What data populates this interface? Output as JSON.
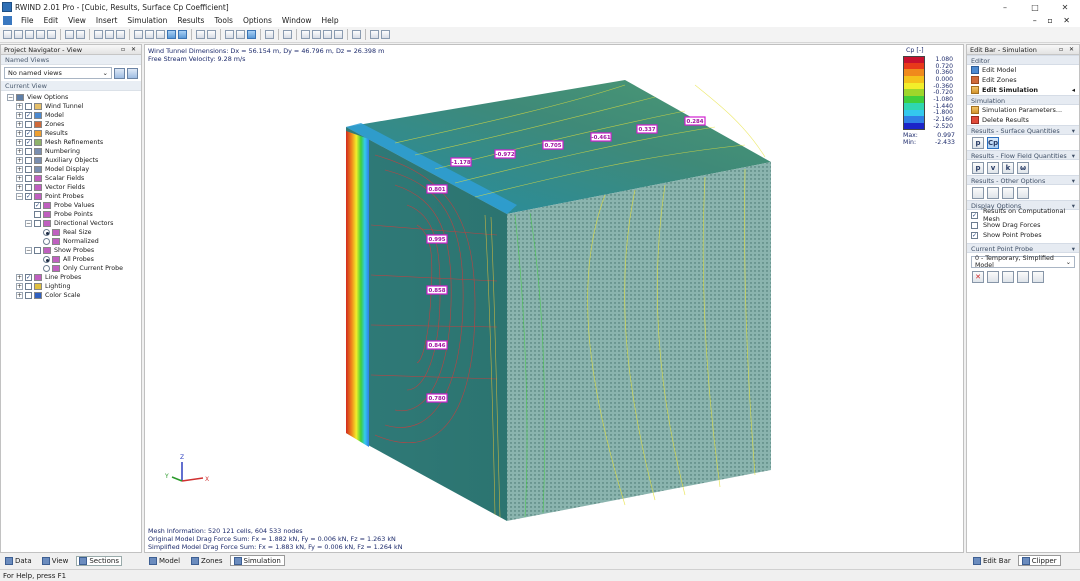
{
  "window": {
    "title": "RWIND 2.01 Pro - [Cubic, Results, Surface Cp Coefficient]",
    "minimize": "–",
    "maximize": "□",
    "close": "✕"
  },
  "menu": {
    "items": [
      "File",
      "Edit",
      "View",
      "Insert",
      "Simulation",
      "Results",
      "Tools",
      "Options",
      "Window",
      "Help"
    ],
    "mdi_controls": "– ▫ ✕"
  },
  "navigator": {
    "title": "Project Navigator - View",
    "pin": "▫ ✕",
    "named_views_label": "Named Views",
    "named_views_value": "No named views",
    "current_view_label": "Current View",
    "tree": [
      {
        "label": "View Options",
        "level": 0,
        "exp": "−",
        "cb": null,
        "icon": "#5f7fa8"
      },
      {
        "label": "Wind Tunnel",
        "level": 1,
        "exp": "+",
        "cb": "",
        "icon": "#e6c06a"
      },
      {
        "label": "Model",
        "level": 1,
        "exp": "+",
        "cb": "✓",
        "icon": "#4d8ad0"
      },
      {
        "label": "Zones",
        "level": 1,
        "exp": "+",
        "cb": "",
        "icon": "#d06a3a"
      },
      {
        "label": "Results",
        "level": 1,
        "exp": "+",
        "cb": "✓",
        "icon": "#f0a030"
      },
      {
        "label": "Mesh Refinements",
        "level": 1,
        "exp": "+",
        "cb": "✓",
        "icon": "#8fb36a"
      },
      {
        "label": "Numbering",
        "level": 1,
        "exp": "+",
        "cb": "",
        "icon": "#7a8fb0"
      },
      {
        "label": "Auxiliary Objects",
        "level": 1,
        "exp": "+",
        "cb": "",
        "icon": "#7a8fb0"
      },
      {
        "label": "Model Display",
        "level": 1,
        "exp": "+",
        "cb": "",
        "icon": "#7a8fb0"
      },
      {
        "label": "Scalar Fields",
        "level": 1,
        "exp": "+",
        "cb": "",
        "icon": "#c060c0"
      },
      {
        "label": "Vector Fields",
        "level": 1,
        "exp": "+",
        "cb": "",
        "icon": "#c060c0"
      },
      {
        "label": "Point Probes",
        "level": 1,
        "exp": "−",
        "cb": "✓",
        "icon": "#c060c0"
      },
      {
        "label": "Probe Values",
        "level": 2,
        "exp": null,
        "cb": "✓",
        "icon": "#c060c0"
      },
      {
        "label": "Probe Points",
        "level": 2,
        "exp": null,
        "cb": "",
        "icon": "#c060c0"
      },
      {
        "label": "Directional Vectors",
        "level": 2,
        "exp": "−",
        "cb": "",
        "icon": "#c060c0"
      },
      {
        "label": "Real Size",
        "level": 3,
        "exp": null,
        "radio": true,
        "icon": "#c060c0"
      },
      {
        "label": "Normalized",
        "level": 3,
        "exp": null,
        "radio": false,
        "icon": "#c060c0"
      },
      {
        "label": "Show Probes",
        "level": 2,
        "exp": "−",
        "cb": "",
        "icon": "#c060c0"
      },
      {
        "label": "All Probes",
        "level": 3,
        "exp": null,
        "radio": true,
        "icon": "#c060c0"
      },
      {
        "label": "Only Current Probe",
        "level": 3,
        "exp": null,
        "radio": false,
        "icon": "#c060c0"
      },
      {
        "label": "Line Probes",
        "level": 1,
        "exp": "+",
        "cb": "✓",
        "icon": "#c060c0"
      },
      {
        "label": "Lighting",
        "level": 1,
        "exp": "+",
        "cb": "",
        "icon": "#e0c040"
      },
      {
        "label": "Color Scale",
        "level": 1,
        "exp": "+",
        "cb": "",
        "icon": "#3060c0"
      }
    ],
    "tabs": [
      "Data",
      "View",
      "Sections"
    ]
  },
  "viewport": {
    "info_top_1": "Wind Tunnel Dimensions: Dx = 56.154 m, Dy = 46.796 m, Dz = 26.398 m",
    "info_top_2": "Free Stream Velocity: 9.28 m/s",
    "info_bottom_1": "Mesh Information: 520 121 cells, 604 533 nodes",
    "info_bottom_2": "Original Model Drag Force Sum: Fx = 1.882 kN, Fy = 0.006 kN, Fz = 1.263 kN",
    "info_bottom_3": "Simplified Model Drag Force Sum: Fx = 1.883 kN, Fy = 0.006 kN, Fz = 1.264 kN",
    "probe_labels": [
      "0.284",
      "0.337",
      "-0.461",
      "0.705",
      "-0.972",
      "-1.178",
      "0.801",
      "0.995",
      "0.858",
      "0.846",
      "0.780"
    ],
    "axes": {
      "x": "X",
      "y": "Y",
      "z": "Z"
    },
    "tabs": [
      "Model",
      "Zones",
      "Simulation"
    ]
  },
  "legend": {
    "title": "Cp [-]",
    "entries": [
      {
        "value": "1.080",
        "color": "#c8102e"
      },
      {
        "value": "0.720",
        "color": "#e8391a"
      },
      {
        "value": "0.360",
        "color": "#f08a1c"
      },
      {
        "value": "0.000",
        "color": "#f5c21b"
      },
      {
        "value": "-0.360",
        "color": "#f2ee2a"
      },
      {
        "value": "-0.720",
        "color": "#9fd62a"
      },
      {
        "value": "-1.080",
        "color": "#3fcf3c"
      },
      {
        "value": "-1.440",
        "color": "#2fd6b0"
      },
      {
        "value": "-1.800",
        "color": "#34c9ee"
      },
      {
        "value": "-2.160",
        "color": "#2f7fe6"
      },
      {
        "value": "-2.520",
        "color": "#1b24c8"
      }
    ],
    "max_label": "Max:",
    "max_value": "0.997",
    "min_label": "Min:",
    "min_value": "-2.433"
  },
  "editbar": {
    "title": "Edit Bar - Simulation",
    "pin": "▫ ✕",
    "editor_label": "Editor",
    "editor_items": [
      "Edit Model",
      "Edit Zones",
      "Edit Simulation"
    ],
    "simulation_label": "Simulation",
    "simulation_items": [
      "Simulation Parameters...",
      "Delete Results"
    ],
    "surface_label": "Results - Surface Quantities",
    "surface_buttons": [
      "p",
      "Cp"
    ],
    "flow_label": "Results - Flow Field Quantities",
    "flow_buttons": [
      "p",
      "v",
      "k",
      "ω"
    ],
    "other_label": "Results - Other Options",
    "display_label": "Display Options",
    "display_items": [
      {
        "label": "Results on Computational Mesh",
        "checked": true
      },
      {
        "label": "Show Drag Forces",
        "checked": false
      },
      {
        "label": "Show Point Probes",
        "checked": true
      }
    ],
    "probe_label": "Current Point Probe",
    "probe_value": "0 - Temporary, Simplified Model",
    "tabs": [
      "Edit Bar",
      "Clipper"
    ]
  },
  "status": {
    "text": "For Help, press F1"
  }
}
